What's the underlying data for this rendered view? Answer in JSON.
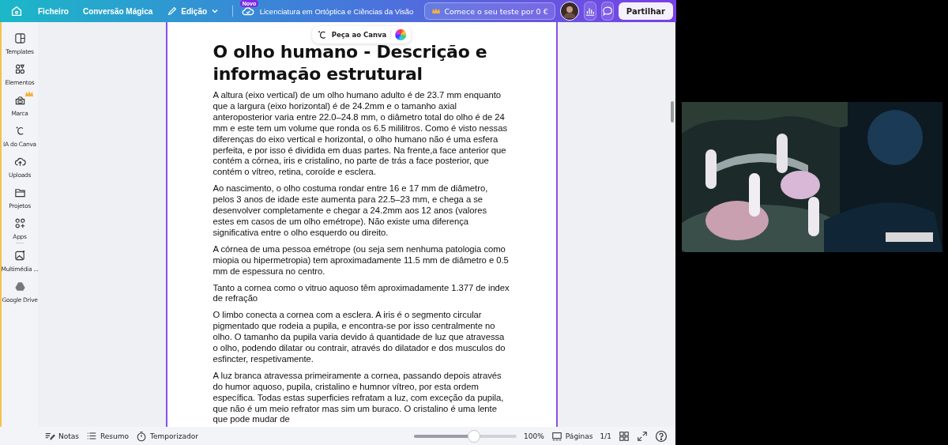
{
  "top_bar": {
    "menu": [
      "Ficheiro",
      "Conversão Mágica"
    ],
    "edit_menu": "Edição",
    "new_badge": "Novo",
    "document_title": "Licenciatura em Ortóptica e Ciências da Visão",
    "trial_button": "Comece o seu teste por 0 €",
    "share_button": "Partilhar"
  },
  "sidebar": {
    "items": [
      {
        "label": "Templates",
        "premium": false
      },
      {
        "label": "Elementos",
        "premium": false
      },
      {
        "label": "Marca",
        "premium": true
      },
      {
        "label": "IA do Canva",
        "premium": false
      },
      {
        "label": "Uploads",
        "premium": false
      },
      {
        "label": "Projetos",
        "premium": false
      },
      {
        "label": "Apps",
        "premium": false
      },
      {
        "label": "Multimédia ...",
        "premium": false
      },
      {
        "label": "Google Drive",
        "premium": false
      }
    ]
  },
  "ask_button": "Peça ao Canva",
  "document": {
    "title": "O olho humano - Descrição e informação estrutural",
    "paragraphs": [
      "A altura (eixo vertical) de um olho humano adulto é de 23.7 mm enquanto que a largura (eixo horizontal) é de 24.2mm e o tamanho axial anteroposterior varia entre 22.0–24.8 mm, o diâmetro total do olho é de 24 mm e este tem um volume que ronda os 6.5 mililitros. Como é visto nessas diferenças do eixo vertical e horizontal, o olho humano não é uma esfera perfeita, e por isso é dividida em duas partes. Na frente,a face anterior que contém a córnea, iris e cristalino, no parte de trás a face posterior, que contém o vítreo, retina, coroíde e esclera.",
      "Ao nascimento, o olho costuma rondar entre 16 e 17 mm de diâmetro, pelos 3 anos de idade este aumenta para 22.5–23 mm, e chega a se desenvolver completamente e chegar a 24.2mm aos 12 anos (valores estes em casos de um olho emétrope). Não existe uma diferença significativa entre o olho esquerdo ou direito.",
      "A córnea de uma pessoa emétrope (ou seja sem nenhuma patologia como miopia ou hipermetropia) tem aproximadamente 11.5 mm de diâmetro e 0.5 mm de espessura no centro.",
      "Tanto a cornea como o vitruo aquoso têm aproximadamente 1.377 de index de refração",
      "O limbo conecta a cornea com a esclera. A iris é o segmento circular pigmentado que rodeia a pupila, e encontra-se por isso centralmente no olho. O tamanho da pupila varia devido á quantidade de luz que atravessa o olho, podendo dilatar ou contrair, através do dilatador e dos musculos do esfincter, respetivamente.",
      "A luz branca atravessa primeiramente a cornea, passando depois através do humor aquoso, pupila, cristalino e humnor vítreo, por esta ordem específica. Todas estas superficies refratam a luz, com exceção da pupila, que não é um meio refrator mas sim um buraco. O cristalino é uma lente que pode mudar de"
    ]
  },
  "bottom_bar": {
    "tools": [
      "Notas",
      "Resumo",
      "Temporizador"
    ],
    "zoom": {
      "level": 0.58,
      "reading": "100%"
    },
    "pages_button": "Páginas",
    "page_count": "1/1"
  }
}
